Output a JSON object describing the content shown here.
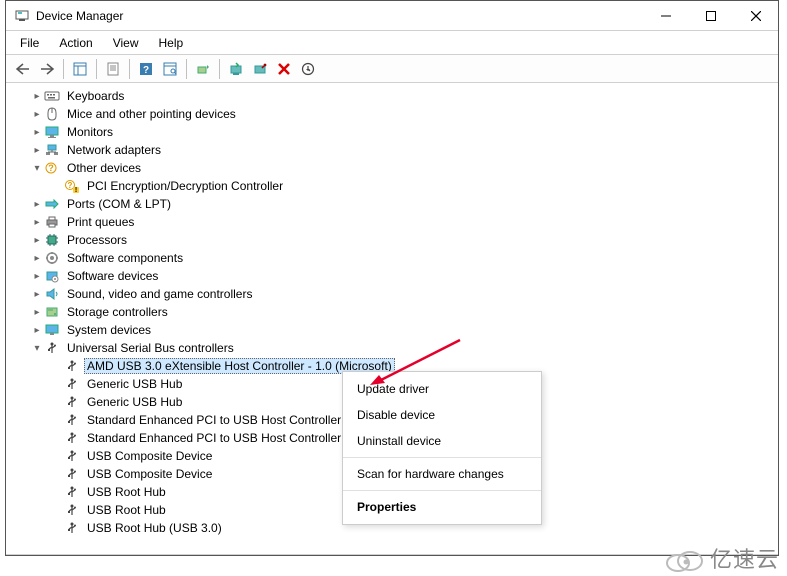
{
  "window": {
    "title": "Device Manager"
  },
  "menu": {
    "file": "File",
    "action": "Action",
    "view": "View",
    "help": "Help"
  },
  "tree": {
    "keyboards": "Keyboards",
    "mice": "Mice and other pointing devices",
    "monitors": "Monitors",
    "network": "Network adapters",
    "other": "Other devices",
    "pci_enc": "PCI Encryption/Decryption Controller",
    "ports": "Ports (COM & LPT)",
    "print": "Print queues",
    "processors": "Processors",
    "softcomp": "Software components",
    "softdev": "Software devices",
    "sound": "Sound, video and game controllers",
    "storage": "Storage controllers",
    "sysdev": "System devices",
    "usb": "Universal Serial Bus controllers",
    "amd_usb3": "AMD USB 3.0 eXtensible Host Controller - 1.0 (Microsoft)",
    "ghub1": "Generic USB Hub",
    "ghub2": "Generic USB Hub",
    "sepci1": "Standard Enhanced PCI to USB Host Controller",
    "sepci2": "Standard Enhanced PCI to USB Host Controller",
    "ucd1": "USB Composite Device",
    "ucd2": "USB Composite Device",
    "uroot1": "USB Root Hub",
    "uroot2": "USB Root Hub",
    "uroot3": "USB Root Hub (USB 3.0)"
  },
  "context": {
    "update": "Update driver",
    "disable": "Disable device",
    "uninstall": "Uninstall device",
    "scan": "Scan for hardware changes",
    "properties": "Properties"
  },
  "watermark": "亿速云"
}
